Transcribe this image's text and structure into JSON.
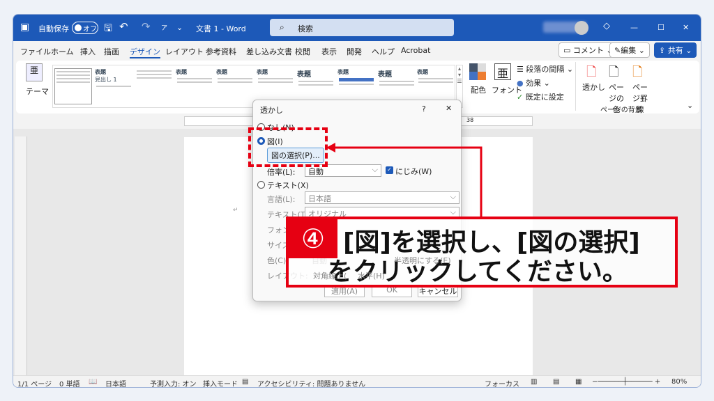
{
  "titlebar": {
    "autosave": "自動保存",
    "toggle": "オフ",
    "title": "文書 1 - Word",
    "search": "検索"
  },
  "tabs": [
    "ファイル",
    "ホーム",
    "挿入",
    "描画",
    "デザイン",
    "レイアウト",
    "参考資料",
    "差し込み文書",
    "校閲",
    "表示",
    "開発",
    "ヘルプ",
    "Acrobat"
  ],
  "active_tab": "デザイン",
  "right_buttons": {
    "comment": "コメント",
    "edit": "編集",
    "share": "共有"
  },
  "ribbon": {
    "theme": "テーマ",
    "style_heading": "表題",
    "style_sub": "見出し 1",
    "colors": "配色",
    "fonts": "フォント",
    "paragraph_spacing": "段落の間隔",
    "effects": "効果",
    "set_default": "既定に設定",
    "watermark": "透かし",
    "page_color": "ページの色",
    "page_borders": "ページ罫線",
    "group_page_background": "ページの背景"
  },
  "ruler": {
    "mark": "38"
  },
  "dialog": {
    "title": "透かし",
    "help": "?",
    "close": "✕",
    "none": "なし(N)",
    "picture": "図(I)",
    "select_picture": "図の選択(P)...",
    "scale_label": "倍率(L):",
    "scale_value": "自動",
    "washout": "にじみ(W)",
    "text": "テキスト(X)",
    "language_label": "言語(L):",
    "language_value": "日本語",
    "text_label": "テキスト(T):",
    "text_value": "オリジナル",
    "font_label": "フォント",
    "size_label": "サイズ(",
    "color_label": "色(C):",
    "color_value": "自動",
    "semitransparent": "半透明にする(E)",
    "layout_label": "レイアウト:",
    "diagonal": "対角線上(",
    "horizontal": "水平(H)",
    "apply": "適用(A)",
    "ok": "OK",
    "cancel": "キャンセル"
  },
  "callout": {
    "number": "④",
    "line1": "[図]を選択し、[図の選択]",
    "line2": "をクリックしてください。",
    "color": "#e60012"
  },
  "status": {
    "page": "1/1 ページ",
    "words": "0 単語",
    "language": "日本語",
    "predict": "予測入力: オン",
    "insert_mode": "挿入モード",
    "accessibility": "アクセシビリティ: 問題ありません",
    "focus": "フォーカス",
    "zoom": "80%"
  }
}
